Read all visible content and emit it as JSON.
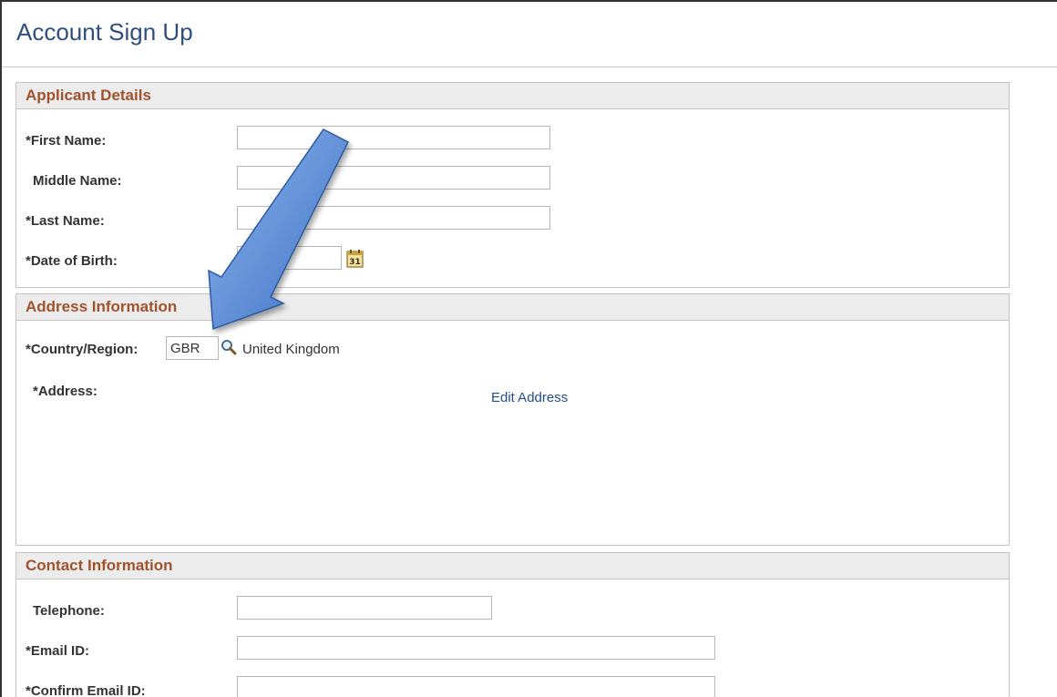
{
  "page": {
    "title": "Account Sign Up"
  },
  "applicant": {
    "header": "Applicant Details",
    "first_name": {
      "label": "*First Name:",
      "value": ""
    },
    "middle_name": {
      "label": "Middle Name:",
      "value": ""
    },
    "last_name": {
      "label": "*Last Name:",
      "value": ""
    },
    "dob": {
      "label": "*Date of Birth:",
      "value": ""
    },
    "calendar_icon": "calendar-icon"
  },
  "address": {
    "header": "Address Information",
    "country": {
      "label": "*Country/Region:",
      "value": "GBR",
      "description": "United Kingdom"
    },
    "lookup_icon": "search-icon",
    "address_label": "*Address:",
    "edit_link": "Edit Address"
  },
  "contact": {
    "header": "Contact Information",
    "telephone": {
      "label": "Telephone:",
      "value": ""
    },
    "email": {
      "label": "*Email ID:",
      "value": ""
    },
    "confirm_email": {
      "label": "*Confirm Email ID:",
      "value": ""
    }
  },
  "colors": {
    "title": "#2f4f7f",
    "section_header": "#a0522d",
    "link": "#1f4e8c",
    "arrow": "#4a7fd0"
  }
}
